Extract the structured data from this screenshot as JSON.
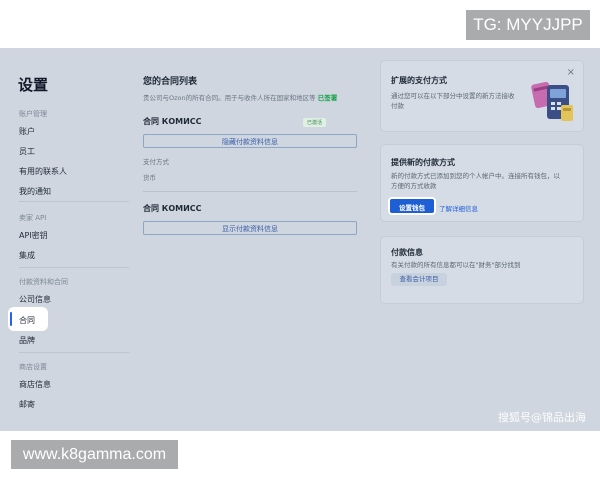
{
  "watermarks": {
    "top": "TG: MYYJJPP",
    "bottom": "www.k8gamma.com",
    "sohu": "搜狐号@锦品出海"
  },
  "sidebar": {
    "title": "设置",
    "sections": [
      {
        "label": "账户管理",
        "items": [
          "账户",
          "员工",
          "有用的联系人",
          "我的通知"
        ]
      },
      {
        "label": "卖家 API",
        "items": [
          "API密钥",
          "集成"
        ]
      },
      {
        "label": "付款资料和合同",
        "items": [
          "公司信息",
          "合同",
          "品牌"
        ]
      },
      {
        "label": "商店设置",
        "items": [
          "商店信息",
          "邮寄"
        ]
      }
    ],
    "active_item": "合同"
  },
  "contracts": {
    "title": "您的合同列表",
    "subtitle": "贵公司与Ozon的所有合同。用于与收件人所在国家和地区等",
    "subtitle_link": "已签署",
    "items": [
      {
        "name": "合同 КОМИСС",
        "badge": "已激活",
        "button": "隐藏付款资料信息",
        "details": [
          {
            "label": "支付方式"
          },
          {
            "label": "货币"
          }
        ]
      },
      {
        "name": "合同 КОМИСС",
        "button": "显示付款资料信息"
      }
    ]
  },
  "cards": {
    "payment_methods": {
      "title": "扩展的支付方式",
      "text": [
        "通过您可以在以下部分中设置的新方法接收",
        "付款"
      ],
      "close": "×"
    },
    "new_payment": {
      "title": "提供新的付款方式",
      "text": [
        "新的付款方式已添加到您的个人帐户中。连接所有钱包，以",
        "方便的方式收款"
      ],
      "primary_button": "设置钱包",
      "link": "了解详细信息"
    },
    "payment_info": {
      "title": "付款信息",
      "text": [
        "有关付款的所有信息都可以在\"财务\"部分找到"
      ],
      "button": "查看会计项目"
    }
  },
  "colors": {
    "accent": "#1f5fd6",
    "overlay": "#cfd6df",
    "success": "#16a34a"
  }
}
